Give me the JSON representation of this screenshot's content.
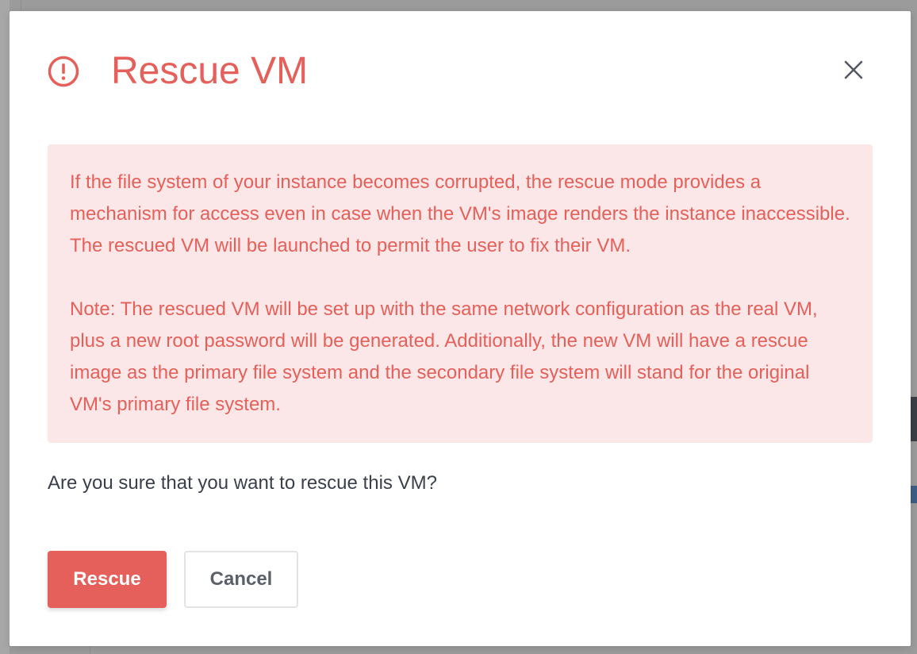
{
  "dialog": {
    "title": "Rescue VM",
    "icon": "exclamation-circle-icon",
    "close_icon": "close-icon",
    "alert": {
      "paragraph1": "If the file system of your instance becomes corrupted, the rescue mode provides a mechanism for access even in case when the VM's image renders the instance inaccessible. The rescued VM will be launched to permit the user to fix their VM.",
      "paragraph2": "Note: The rescued VM will be set up with the same network configuration as the real VM, plus a new root password will be generated. Additionally, the new VM will have a rescue image as the primary file system and the secondary file system will stand for the original VM's primary file system."
    },
    "question": "Are you sure that you want to rescue this VM?",
    "buttons": {
      "rescue": "Rescue",
      "cancel": "Cancel"
    }
  },
  "colors": {
    "accent": "#e5605a",
    "alert_background": "#fbe7e7",
    "backdrop": "#9b9b9b",
    "text": "#3a3f4a"
  }
}
